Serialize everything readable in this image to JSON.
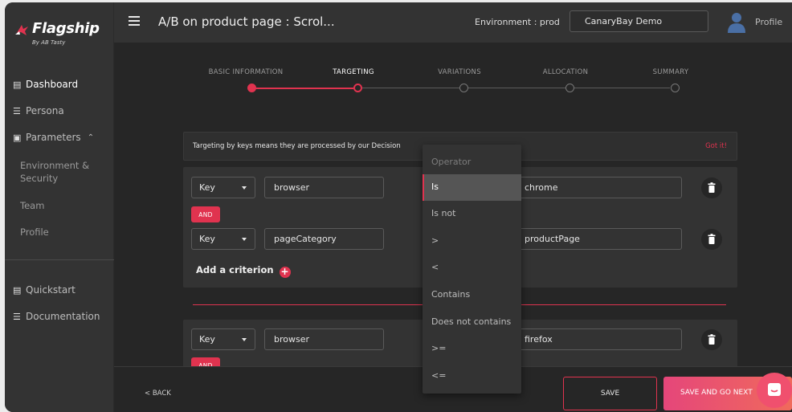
{
  "app": {
    "brand": "Flagship",
    "brand_sub": "By AB Tasty",
    "title": "A/B on product page : Scrol...",
    "environment_label": "Environment : prod",
    "environment_value": "CanaryBay Demo",
    "profile_label": "Profile"
  },
  "sidebar": {
    "items": [
      {
        "label": "Dashboard",
        "icon": "dashboard-icon"
      },
      {
        "label": "Persona",
        "icon": "list-icon"
      },
      {
        "label": "Parameters",
        "icon": "settings-box-icon"
      },
      {
        "label": "Quickstart",
        "icon": "dashboard-icon"
      },
      {
        "label": "Documentation",
        "icon": "list-icon"
      }
    ],
    "sub_items": [
      "Environment &\nSecurity",
      "Team",
      "Profile"
    ]
  },
  "stepper": {
    "steps": [
      "BASIC INFORMATION",
      "TARGETING",
      "VARIATIONS",
      "ALLOCATION",
      "SUMMARY"
    ],
    "current": "TARGETING"
  },
  "info": {
    "text": "Targeting by keys means they are processed by our Decision",
    "dismiss": "Got it!"
  },
  "group1": {
    "rows": [
      {
        "key": "Key",
        "field": "browser",
        "value": "chrome"
      },
      {
        "key": "Key",
        "field": "pageCategory",
        "value": "productPage"
      }
    ],
    "and_label": "AND",
    "add_label": "Add a criterion"
  },
  "group2": {
    "rows": [
      {
        "key": "Key",
        "field": "browser",
        "value": "firefox"
      }
    ],
    "and_label": "AND"
  },
  "dropdown": {
    "header": "Operator",
    "options": [
      "Is",
      "Is not",
      ">",
      "<",
      "Contains",
      "Does not contains",
      ">=",
      "<="
    ],
    "selected": "Is"
  },
  "footer": {
    "back": "< BACK",
    "save": "SAVE",
    "save_next": "SAVE AND GO NEXT"
  },
  "colors": {
    "accent": "#e0334f",
    "gradient_start": "#e5467a",
    "gradient_end": "#f06a5c"
  }
}
